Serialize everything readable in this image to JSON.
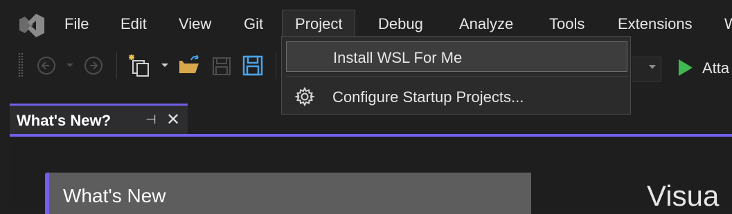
{
  "menubar": {
    "items": [
      "File",
      "Edit",
      "View",
      "Git",
      "Project",
      "Debug",
      "Analyze",
      "Tools",
      "Extensions"
    ],
    "active_item": "Project"
  },
  "toolbar": {
    "icons": [
      "grip-icon",
      "back-icon",
      "dropdown-arrow-icon",
      "forward-icon",
      "new-project-icon",
      "open-folder-icon",
      "save-icon",
      "save-all-icon"
    ],
    "attach_label": "Atta"
  },
  "project_menu": {
    "items": [
      {
        "label": "Install WSL For Me",
        "icon": "",
        "highlighted": true
      },
      {
        "label": "Configure Startup Projects...",
        "icon": "gear-icon",
        "highlighted": false
      }
    ]
  },
  "document_tab": {
    "title": "What's New?",
    "pin_glyph": "⊣",
    "close_glyph": "✕"
  },
  "content": {
    "card_title": "What's New",
    "right_heading": "Visua"
  },
  "colors": {
    "accent": "#7160e8",
    "background": "#1f1f1f",
    "menu_bg": "#2b2b2b",
    "play_green": "#3fb950"
  }
}
